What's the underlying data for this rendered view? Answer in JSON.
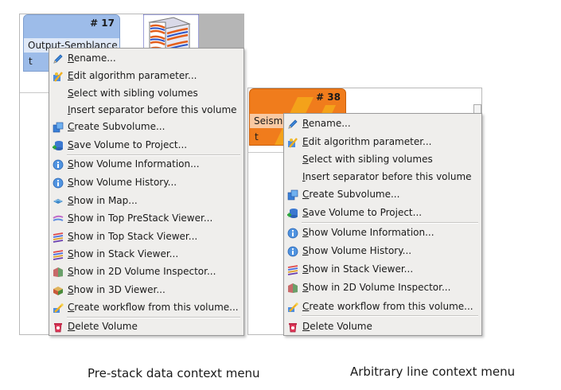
{
  "left": {
    "tile": {
      "number": "# 17",
      "name": "Output-Semblance",
      "tag": "t"
    },
    "menu": [
      {
        "label": "Rename...",
        "icon": "pencil-icon"
      },
      {
        "label": "Edit algorithm parameter...",
        "icon": "algorithm-icon"
      },
      {
        "label": "Select with sibling volumes",
        "icon": ""
      },
      {
        "label": "Insert separator before this volume",
        "icon": ""
      },
      {
        "label": "Create Subvolume...",
        "icon": "subvolume-icon"
      },
      {
        "label": "Save Volume to Project...",
        "icon": "save-database-icon"
      },
      {
        "label": "Show Volume Information...",
        "icon": "info-icon"
      },
      {
        "label": "Show Volume History...",
        "icon": "info-icon"
      },
      {
        "label": "Show in Map...",
        "icon": "map-icon"
      },
      {
        "label": "Show in Top PreStack Viewer...",
        "icon": "prestack-viewer-icon"
      },
      {
        "label": "Show in Top Stack Viewer...",
        "icon": "stack-viewer-icon"
      },
      {
        "label": "Show in Stack Viewer...",
        "icon": "stack-viewer-icon"
      },
      {
        "label": "Show in 2D Volume Inspector...",
        "icon": "inspector-icon"
      },
      {
        "label": "Show in 3D Viewer...",
        "icon": "3d-viewer-icon"
      },
      {
        "label": "Create workflow from this volume...",
        "icon": "workflow-icon"
      },
      {
        "label": "Delete Volume",
        "icon": "delete-icon"
      }
    ],
    "caption": "Pre-stack data context menu"
  },
  "right": {
    "tile": {
      "number": "# 38",
      "name": "Seism",
      "tag": "t"
    },
    "menu": [
      {
        "label": "Rename...",
        "icon": "pencil-icon"
      },
      {
        "label": "Edit algorithm parameter...",
        "icon": "algorithm-icon"
      },
      {
        "label": "Select with sibling volumes",
        "icon": ""
      },
      {
        "label": "Insert separator before this volume",
        "icon": ""
      },
      {
        "label": "Create Subvolume...",
        "icon": "subvolume-icon"
      },
      {
        "label": "Save Volume to Project...",
        "icon": "save-database-icon"
      },
      {
        "label": "Show Volume Information...",
        "icon": "info-icon"
      },
      {
        "label": "Show Volume History...",
        "icon": "info-icon"
      },
      {
        "label": "Show in Stack Viewer...",
        "icon": "stack-viewer-icon"
      },
      {
        "label": "Show in 2D Volume Inspector...",
        "icon": "inspector-icon"
      },
      {
        "label": "Create workflow from this volume...",
        "icon": "workflow-icon"
      },
      {
        "label": "Delete Volume",
        "icon": "delete-icon"
      }
    ],
    "caption": "Arbitrary line context menu"
  },
  "colors": {
    "left_tile": "#9dbce9",
    "left_tile_name": "#dfe8f7",
    "right_tile": "#f07c1c",
    "right_tile_name": "#f9c9a2",
    "menu_bg": "#efeeec"
  }
}
